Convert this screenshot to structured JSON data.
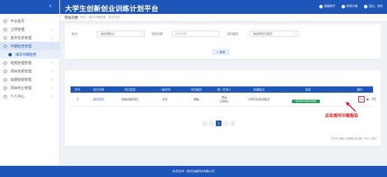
{
  "header": {
    "title": "大学生创新创业训练计划平台",
    "links": [
      "智能助手",
      "修改头像",
      "退出，张先"
    ]
  },
  "sidebar": {
    "collapse_icon": "chevron-left-icon",
    "items": [
      {
        "label": "平台首页",
        "active": false
      },
      {
        "label": "立项管理",
        "active": false
      },
      {
        "label": "基本信息管理",
        "active": false
      },
      {
        "label": "中期检查管理",
        "active": true
      },
      {
        "label": "填写中期检查",
        "sub": true
      },
      {
        "label": "结题管理管理",
        "active": false
      },
      {
        "label": "项目变更管理",
        "active": false
      },
      {
        "label": "延期结题管理",
        "active": false
      },
      {
        "label": "项目终止管理",
        "active": false
      },
      {
        "label": "个人中心",
        "active": false
      }
    ]
  },
  "breadcrumb": {
    "page_title": "项目列表",
    "path": "首页 › 填写中期检查 › 项目列表"
  },
  "filters": {
    "batch_label": "批次",
    "batch_value": "请选择批次",
    "name_label": "项目名称",
    "name_placeholder": "项目名称",
    "type_label": "项目类型",
    "type_value": "请选择项目类型",
    "query_button": "查询"
  },
  "table": {
    "headers": [
      "序号",
      "项目名称",
      "项目类型",
      "一级学科",
      "项目级别",
      "第一负责人",
      "所属批次",
      "状态",
      "操作"
    ],
    "rows": [
      {
        "index": "1",
        "name": "测试项目",
        "type": "创新训练项目",
        "discipline": "文学",
        "level": "院级",
        "leader": "李云",
        "leader_id": "(1001)",
        "batch": "2022年测试批次",
        "status": "填写学科中期检查报告"
      }
    ]
  },
  "pagination": {
    "first": "«",
    "prev": "‹",
    "current": "1",
    "next": "›",
    "last": "»",
    "info": "共1页 (每页,当前第1页)(第 1 页/1 记录)"
  },
  "annotation": "点击填写中期报告",
  "footer": {
    "text": "技术支持：南京先越科技有限公司"
  },
  "colors": {
    "primary": "#1d56b8",
    "status_green": "#1aa15a",
    "annotation_red": "#e11111"
  }
}
